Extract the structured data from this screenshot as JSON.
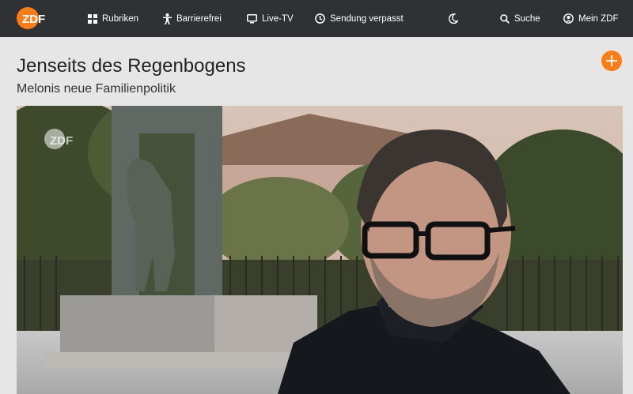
{
  "header": {
    "logo_text": "ZDF",
    "nav": [
      {
        "label": "Rubriken",
        "icon": "grid-icon"
      },
      {
        "label": "Barrierefrei",
        "icon": "accessibility-icon"
      },
      {
        "label": "Live-TV",
        "icon": "tv-icon"
      },
      {
        "label": "Sendung verpasst",
        "icon": "clock-icon"
      }
    ],
    "theme_toggle_icon": "moon-icon",
    "search_label": "Suche",
    "search_icon": "search-icon",
    "account_label": "Mein ZDF",
    "account_icon": "user-circle-icon"
  },
  "page": {
    "title": "Jenseits des Regenbogens",
    "subtitle": "Melonis neue Familienpolitik",
    "add_icon": "plus-icon"
  },
  "video": {
    "watermark": "ZDF"
  },
  "colors": {
    "header_bg": "#303134",
    "accent": "#fa7d19",
    "page_bg": "#e6e6e6"
  }
}
